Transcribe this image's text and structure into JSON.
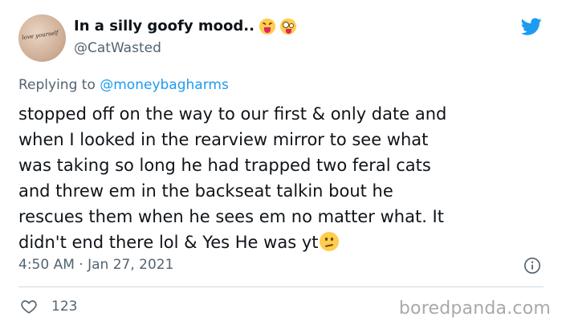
{
  "author": {
    "display_name": "In a silly goofy mood..",
    "handle": "@CatWasted",
    "avatar_ink": "love yourself"
  },
  "reply": {
    "prefix": "Replying to",
    "mention": "@moneybagharms"
  },
  "tweet": {
    "lines": [
      "stopped off on the way to our first & only date and",
      "when I looked in the rearview mirror to see what",
      "was taking so long he had trapped two feral cats",
      "and threw em in the backseat talkin bout he",
      "rescues them when he sees em no matter what. It",
      "didn't end there lol & Yes He was yt"
    ],
    "timestamp": "4:50 AM · Jan 27, 2021"
  },
  "engagement": {
    "likes": "123"
  },
  "watermark": "boredpanda.com",
  "colors": {
    "twitter_blue": "#1d9bf0",
    "muted": "#536471",
    "text": "#0f1419"
  },
  "icons": [
    "twitter-bird-icon",
    "squinting-tongue-emoji",
    "zany-face-emoji",
    "confused-face-emoji",
    "info-icon",
    "heart-icon"
  ]
}
